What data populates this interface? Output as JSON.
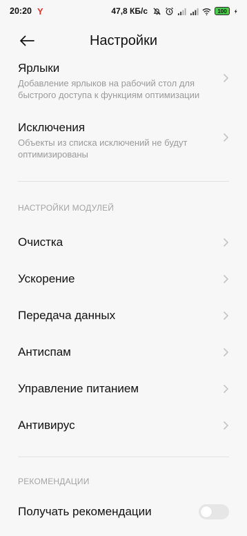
{
  "status": {
    "time": "20:20",
    "operator_icon": "Y",
    "speed": "47,8 КБ/с",
    "battery": "100"
  },
  "header": {
    "title": "Настройки"
  },
  "items_top": [
    {
      "title": "Ярлыки",
      "description": "Добавление ярлыков на рабочий стол для быстрого доступа к функциям оптимизации"
    },
    {
      "title": "Исключения",
      "description": "Объекты из списка исключений не будут оптимизированы"
    }
  ],
  "modules": {
    "header": "НАСТРОЙКИ МОДУЛЕЙ",
    "items": [
      "Очистка",
      "Ускорение",
      "Передача данных",
      "Антиспам",
      "Управление питанием",
      "Антивирус"
    ]
  },
  "recommendations": {
    "header": "РЕКОМЕНДАЦИИ",
    "items": [
      {
        "label": "Получать рекомендации",
        "enabled": false
      }
    ]
  }
}
